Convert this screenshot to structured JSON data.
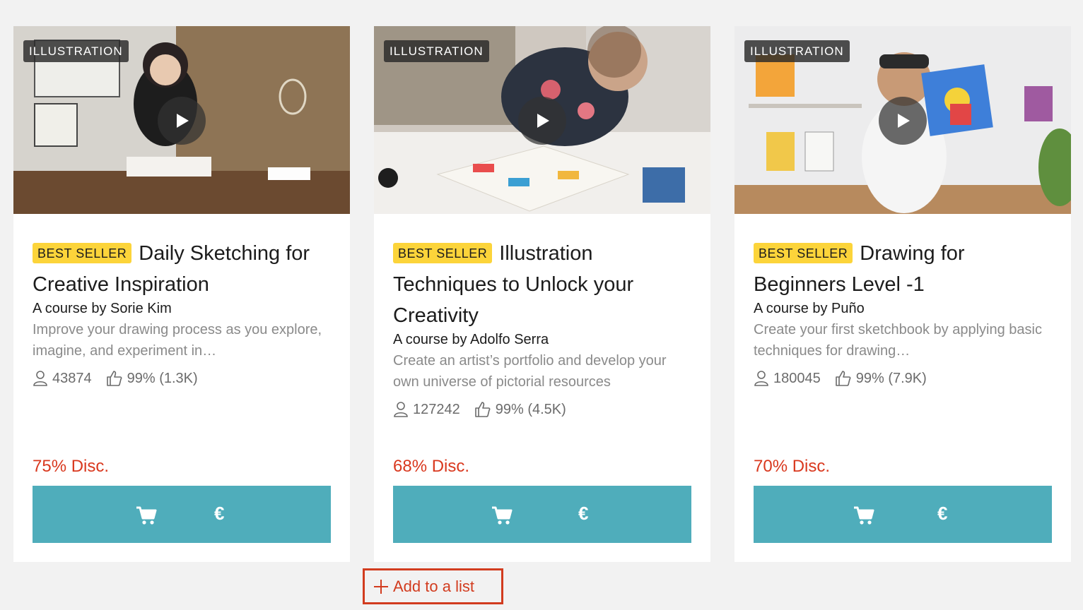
{
  "courses": [
    {
      "category": "ILLUSTRATION",
      "badge": "BEST SELLER",
      "title": "Daily Sketching for Creative Inspiration",
      "author": "A course by Sorie Kim",
      "description": "Improve your drawing process as you explore, imagine, and experiment in…",
      "students": "43874",
      "rating": "99% (1.3K)",
      "discount": "75% Disc.",
      "currency_symbol": "€"
    },
    {
      "category": "ILLUSTRATION",
      "badge": "BEST SELLER",
      "title": "Illustration Techniques to Unlock your Creativity",
      "author": "A course by Adolfo Serra",
      "description": "Create an artist’s portfolio and develop your own universe of pictorial resources",
      "students": "127242",
      "rating": "99% (4.5K)",
      "discount": "68% Disc.",
      "currency_symbol": "€"
    },
    {
      "category": "ILLUSTRATION",
      "badge": "BEST SELLER",
      "title": "Drawing for Beginners Level -1",
      "author": "A course by Puño",
      "description": "Create your first sketchbook by applying basic techniques for drawing…",
      "students": "180045",
      "rating": "99% (7.9K)",
      "discount": "70% Disc.",
      "currency_symbol": "€"
    }
  ],
  "add_to_list": {
    "label": "Add to a list"
  },
  "colors": {
    "accent_button": "#4fadbb",
    "discount": "#d9381e",
    "best_seller_badge": "#fcd43a",
    "highlight_box": "#d23c1f"
  },
  "icons": [
    "play-icon",
    "user-icon",
    "thumbs-up-icon",
    "cart-icon",
    "plus-icon"
  ]
}
